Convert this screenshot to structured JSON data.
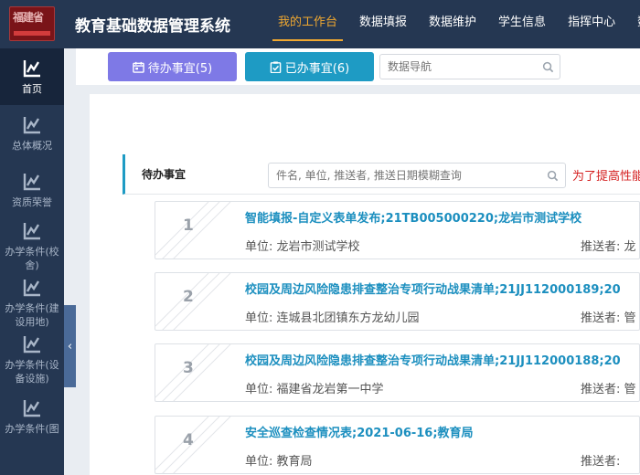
{
  "header": {
    "logo_text": "福建省",
    "title": "教育基础数据管理系统",
    "nav": [
      "我的工作台",
      "数据填报",
      "数据维护",
      "学生信息",
      "指挥中心",
      "数据"
    ]
  },
  "sidebar": {
    "items": [
      {
        "label": "首页",
        "icon": "chart-line-icon"
      },
      {
        "label": "总体概况",
        "icon": "chart-line-icon"
      },
      {
        "label": "资质荣誉",
        "icon": "chart-line-icon"
      },
      {
        "label": "办学条件(校舍)",
        "icon": "chart-line-icon"
      },
      {
        "label": "办学条件(建设用地)",
        "icon": "chart-line-icon"
      },
      {
        "label": "办学条件(设备设施)",
        "icon": "chart-line-icon"
      },
      {
        "label": "办学条件(图",
        "icon": "chart-line-icon"
      }
    ],
    "collapse_glyph": "‹"
  },
  "toolbar": {
    "pending_label": "待办事宜(5)",
    "done_label": "已办事宜(6)",
    "nav_search_placeholder": "数据导航"
  },
  "section": {
    "title": "待办事宜",
    "filter_placeholder": "件名, 单位, 推送者, 推送日期模糊查询",
    "notice": "为了提高性能"
  },
  "tasks": [
    {
      "num": "1",
      "title": "智能填报-自定义表单发布;21TB005000220;龙岩市测试学校",
      "unit": "单位:  龙岩市测试学校",
      "sender": "推送者:  龙"
    },
    {
      "num": "2",
      "title": "校园及周边风险隐患排查整治专项行动战果清单;21JJ112000189;20",
      "unit": "单位:  连城县北团镇东方龙幼儿园",
      "sender": "推送者:  管"
    },
    {
      "num": "3",
      "title": "校园及周边风险隐患排查整治专项行动战果清单;21JJ112000188;20",
      "unit": "单位:  福建省龙岩第一中学",
      "sender": "推送者:  管"
    },
    {
      "num": "4",
      "title": "安全巡查检查情况表;2021-06-16;教育局",
      "unit": "单位:  教育局",
      "sender": "推送者:"
    }
  ],
  "colors": {
    "header_bg": "#253752",
    "accent_orange": "#f0a830",
    "pending_purple": "#7e79e6",
    "done_blue": "#1e9bc4",
    "title_blue": "#1c8fbf",
    "notice_red": "#d42020"
  }
}
